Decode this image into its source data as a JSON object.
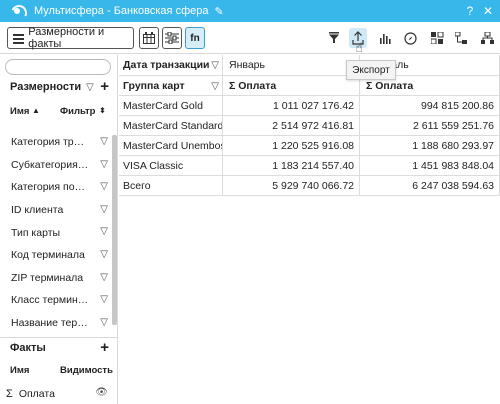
{
  "window": {
    "title": "Мультисфера - Банковская сфера",
    "edit_icon": "pencil-icon",
    "controls": [
      "help-icon",
      "close-icon"
    ]
  },
  "toolbar": {
    "dims_button_label": "Размерности и факты",
    "fn_label": "fn",
    "left_icons": [
      "table-layout-icon",
      "sliders-icon"
    ],
    "right_icons": [
      "filter-icon",
      "export-icon",
      "chart-icon",
      "compass-icon",
      "swap-axes-icon",
      "tree-icon",
      "hierarchy-icon"
    ]
  },
  "tooltip": {
    "text": "Экспорт"
  },
  "left_panel": {
    "search_placeholder": "",
    "dimensions_header": "Размерности",
    "dim_col_name": "Имя",
    "dim_col_filter": "Фильтр",
    "dimensions": [
      "Категория транзакции",
      "Субкатегория транзакции",
      "Категория покупки",
      "ID клиента",
      "Тип карты",
      "Код терминала",
      "ZIP терминала",
      "Класс терминала",
      "Название терминала"
    ],
    "facts_header": "Факты",
    "fact_col_name": "Имя",
    "fact_col_visibility": "Видимость",
    "facts": [
      {
        "label": "Оплата"
      }
    ]
  },
  "grid": {
    "col_dim_header": "Дата транзакции",
    "months": [
      "Январь",
      "Февраль"
    ],
    "row_dim_header": "Группа карт",
    "measure_label": "Σ Оплата",
    "rows": [
      {
        "label": "MasterCard Gold",
        "jan": "1 011 027 176.42",
        "feb": "994 815 200.86"
      },
      {
        "label": "MasterCard Standard",
        "jan": "2 514 972 416.81",
        "feb": "2 611 559 251.76"
      },
      {
        "label": "MasterCard Unembossed",
        "jan": "1 220 525 916.08",
        "feb": "1 188 680 293.97"
      },
      {
        "label": "VISA Classic",
        "jan": "1 183 214 557.40",
        "feb": "1 451 983 848.04"
      },
      {
        "label": "Всего",
        "jan": "5 929 740 066.72",
        "feb": "6 247 038 594.63"
      }
    ]
  },
  "colors": {
    "titlebar": "#37b7ea",
    "active_button_bg": "#d6eef8"
  }
}
